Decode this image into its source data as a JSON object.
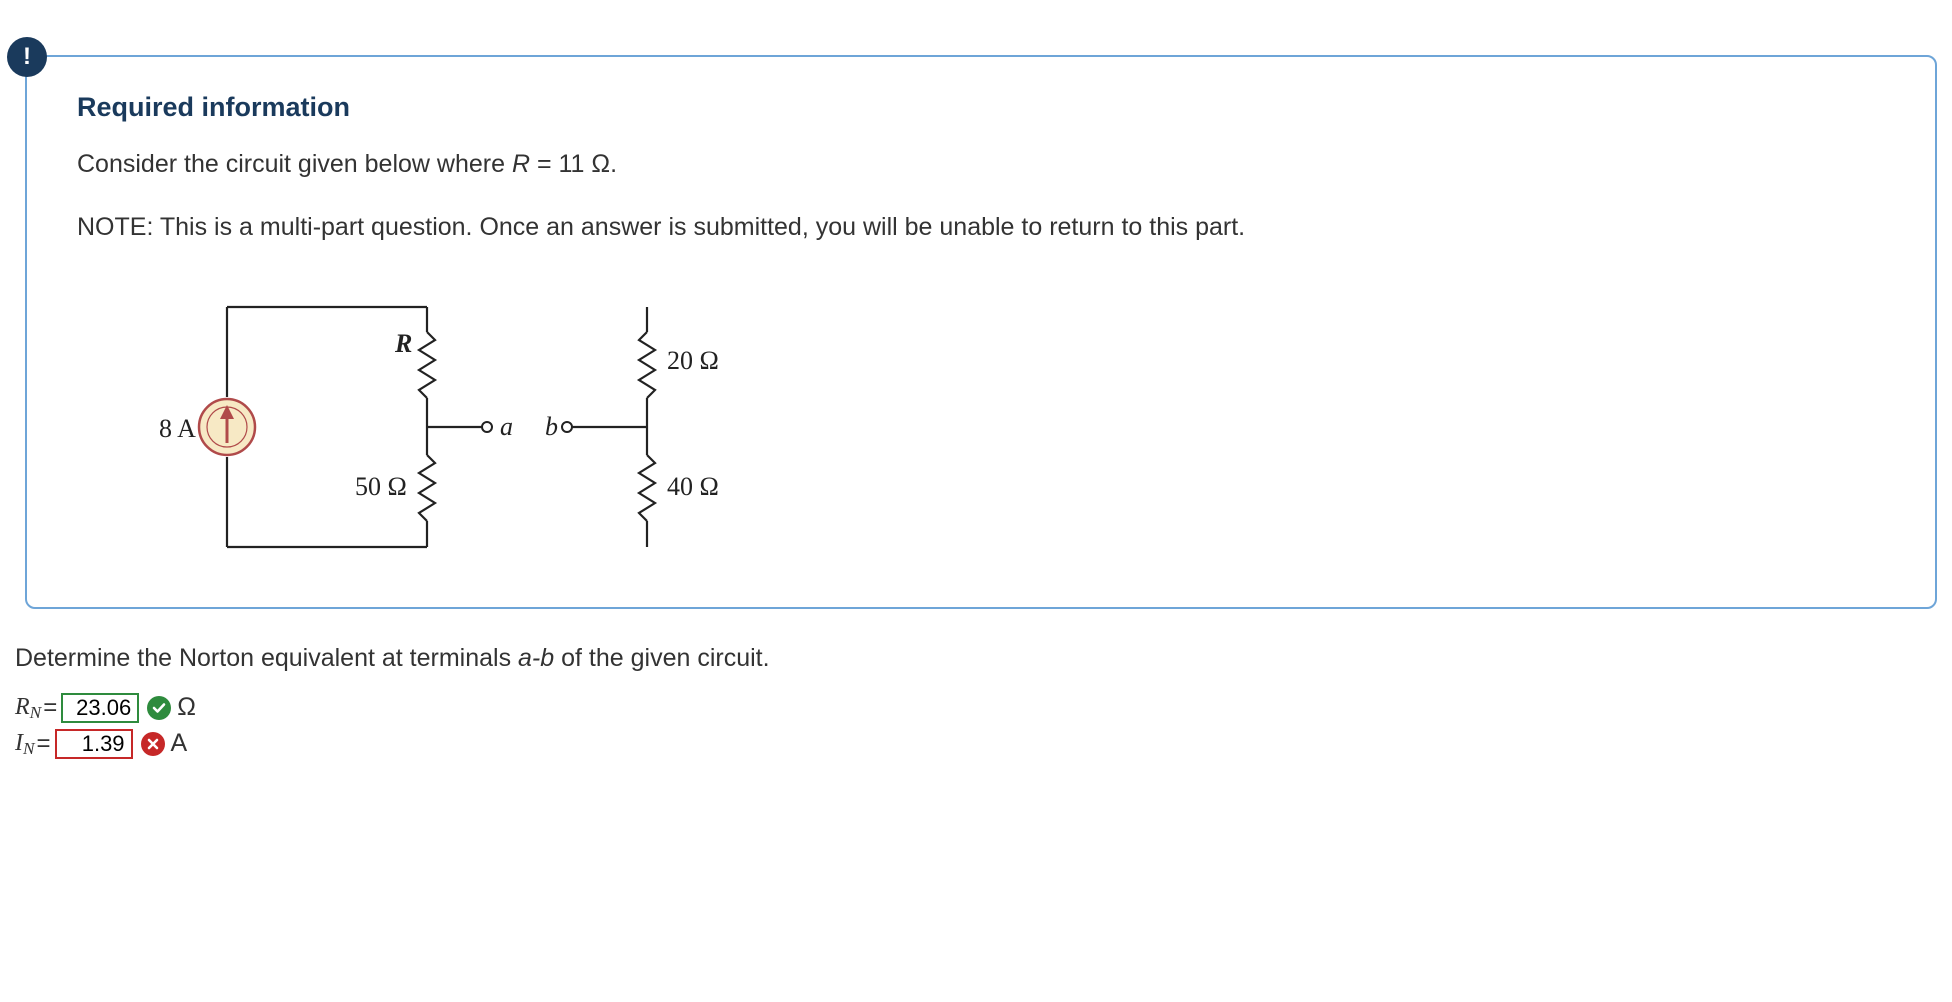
{
  "callout": {
    "title": "Required information",
    "intro_prefix": "Consider the circuit given below where ",
    "intro_var": "R",
    "intro_eq": " = 11 Ω.",
    "note": "NOTE: This is a multi-part question. Once an answer is submitted, you will be unable to return to this part."
  },
  "circuit": {
    "source_label": "8 A",
    "r_label": "R",
    "r50": "50 Ω",
    "r20": "20 Ω",
    "r40": "40 Ω",
    "term_a": "a",
    "term_b": "b"
  },
  "question_prefix": "Determine the Norton equivalent at terminals ",
  "question_terms": "a-b",
  "question_suffix": " of the given circuit.",
  "answers": {
    "rn": {
      "var": "R",
      "sub": "N",
      "value": "23.06",
      "unit": "Ω",
      "status": "correct"
    },
    "in": {
      "var": "I",
      "sub": "N",
      "value": "1.39",
      "unit": "A",
      "status": "wrong"
    }
  }
}
